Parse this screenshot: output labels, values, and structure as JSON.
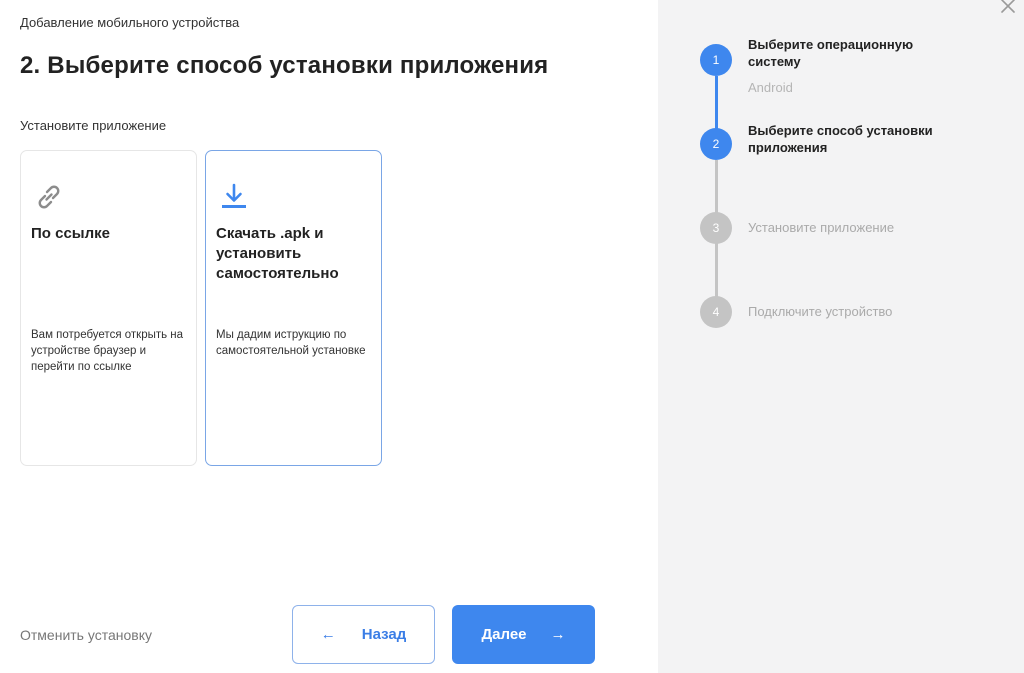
{
  "breadcrumb": "Добавление мобильного устройства",
  "title": "2. Выберите способ установки приложения",
  "section_label": "Установите приложение",
  "cards": [
    {
      "title": "По ссылке",
      "description": "Вам потребуется открыть на устройстве браузер и перейти по ссылке",
      "icon": "link-icon",
      "selected": false
    },
    {
      "title": "Скачать .apk и установить самостоятельно",
      "description": "Мы дадим иструкцию по самостоятельной установке",
      "icon": "download-icon",
      "selected": true
    }
  ],
  "footer": {
    "cancel_label": "Отменить установку",
    "back_label": "Назад",
    "next_label": "Далее"
  },
  "steps": [
    {
      "number": "1",
      "title": "Выберите операционную систему",
      "subtitle": "Android",
      "state": "done"
    },
    {
      "number": "2",
      "title": "Выберите способ установки приложения",
      "subtitle": "",
      "state": "current"
    },
    {
      "number": "3",
      "title": "Установите приложение",
      "subtitle": "",
      "state": "pending"
    },
    {
      "number": "4",
      "title": "Подключите устройство",
      "subtitle": "",
      "state": "pending"
    }
  ],
  "colors": {
    "accent": "#3e87ee",
    "inactive_step": "#c4c4c4",
    "sidebar_bg": "#f3f3f4"
  }
}
